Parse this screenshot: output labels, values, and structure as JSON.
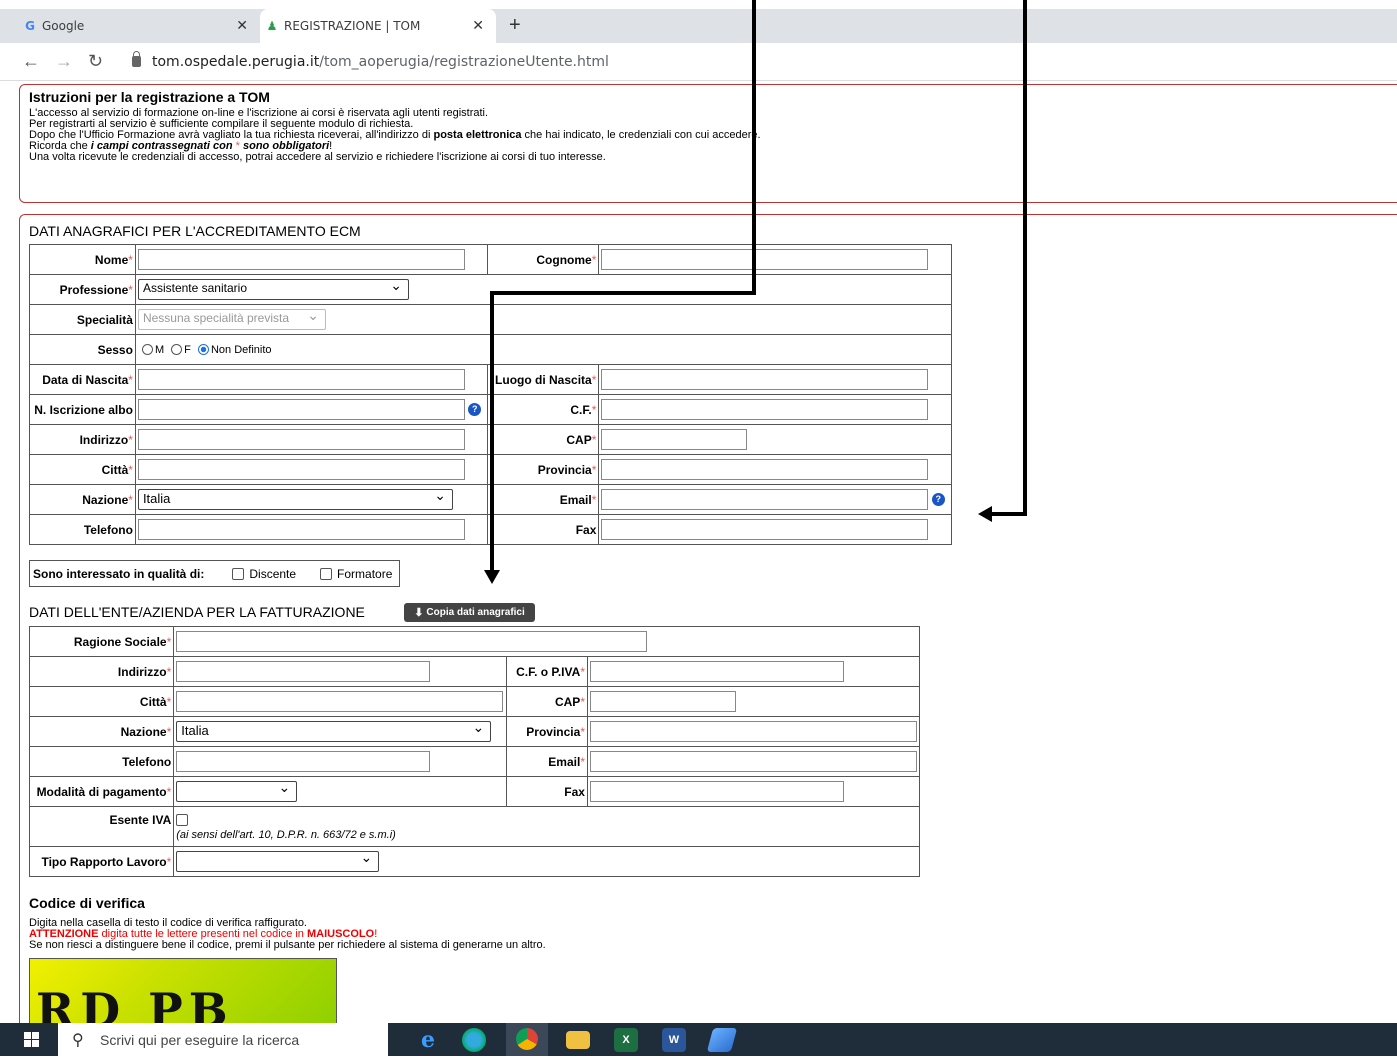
{
  "browser": {
    "tabs": [
      {
        "label": "Google",
        "icon": "G"
      },
      {
        "label": "REGISTRAZIONE | TOM",
        "icon": "person"
      }
    ],
    "new_tab": "+",
    "url_host": "tom.ospedale.perugia.it",
    "url_path": "/tom_aoperugia/registrazioneUtente.html"
  },
  "instructions": {
    "title": "Istruzioni per la registrazione a TOM",
    "line1": "L'accesso al servizio di formazione on-line e l'iscrizione ai corsi è riservata agli utenti registrati.",
    "line2": "Per registrarti al servizio è sufficiente compilare il seguente modulo di richiesta.",
    "line3a": "Dopo che l'Ufficio Formazione avrà vagliato la tua richiesta riceverai, all'indirizzo di ",
    "line3b": "posta elettronica",
    "line3c": " che hai indicato, le credenziali con cui accedere.",
    "line4a": "Ricorda che ",
    "line4b": "i campi contrassegnati con",
    "line4c": " * ",
    "line4d": "sono obbligatori",
    "line4e": "!",
    "line5": "Una volta ricevute le credenziali di accesso, potrai accedere al servizio e richiedere l'iscrizione ai corsi di tuo interesse."
  },
  "anagrafici": {
    "title": "DATI ANAGRAFICI PER L'ACCREDITAMENTO ECM",
    "nome": "Nome",
    "cognome": "Cognome",
    "professione": "Professione",
    "professione_value": "Assistente sanitario",
    "specialita": "Specialità",
    "specialita_value": "Nessuna specialità prevista",
    "sesso": "Sesso",
    "sesso_m": "M",
    "sesso_f": "F",
    "sesso_nd": "Non Definito",
    "data_nascita": "Data di Nascita",
    "luogo_nascita": "Luogo di Nascita",
    "iscrizione_albo": "N. Iscrizione albo",
    "cf": "C.F.",
    "indirizzo": "Indirizzo",
    "cap": "CAP",
    "citta": "Città",
    "provincia": "Provincia",
    "nazione": "Nazione",
    "nazione_value": "Italia",
    "email": "Email",
    "telefono": "Telefono",
    "fax": "Fax"
  },
  "interesse": {
    "label": "Sono interessato in qualità di:",
    "discente": "Discente",
    "formatore": "Formatore"
  },
  "fatturazione": {
    "title": "DATI DELL'ENTE/AZIENDA PER LA FATTURAZIONE",
    "copy_button": "Copia dati anagrafici",
    "ragione_sociale": "Ragione Sociale",
    "indirizzo": "Indirizzo",
    "cf_piva": "C.F. o P.IVA",
    "citta": "Città",
    "cap": "CAP",
    "nazione": "Nazione",
    "nazione_value": "Italia",
    "provincia": "Provincia",
    "telefono": "Telefono",
    "email": "Email",
    "modalita": "Modalità di pagamento",
    "fax": "Fax",
    "esente_iva": "Esente IVA",
    "esente_note": "(ai sensi dell'art. 10, D.P.R. n. 663/72 e s.m.i)",
    "tipo_rapporto": "Tipo Rapporto Lavoro"
  },
  "verifica": {
    "title": "Codice di verifica",
    "line1": "Digita nella casella di testo il codice di verifica raffigurato.",
    "line2a": "ATTENZIONE",
    "line2b": " digita tutte le lettere presenti nel codice in ",
    "line2c": "MAIUSCOLO",
    "line2d": "!",
    "line3": "Se non riesci a distinguere bene il codice, premi il pulsante per richiedere al sistema di generarne un altro.",
    "captcha_text": "RD PB KU"
  },
  "req_mark": "*",
  "taskbar": {
    "search_placeholder": "Scrivi qui per eseguire la ricerca"
  },
  "colors": {
    "border_red": "#b33333",
    "required": "#ee5555",
    "taskbar": "#1f2c3a"
  }
}
